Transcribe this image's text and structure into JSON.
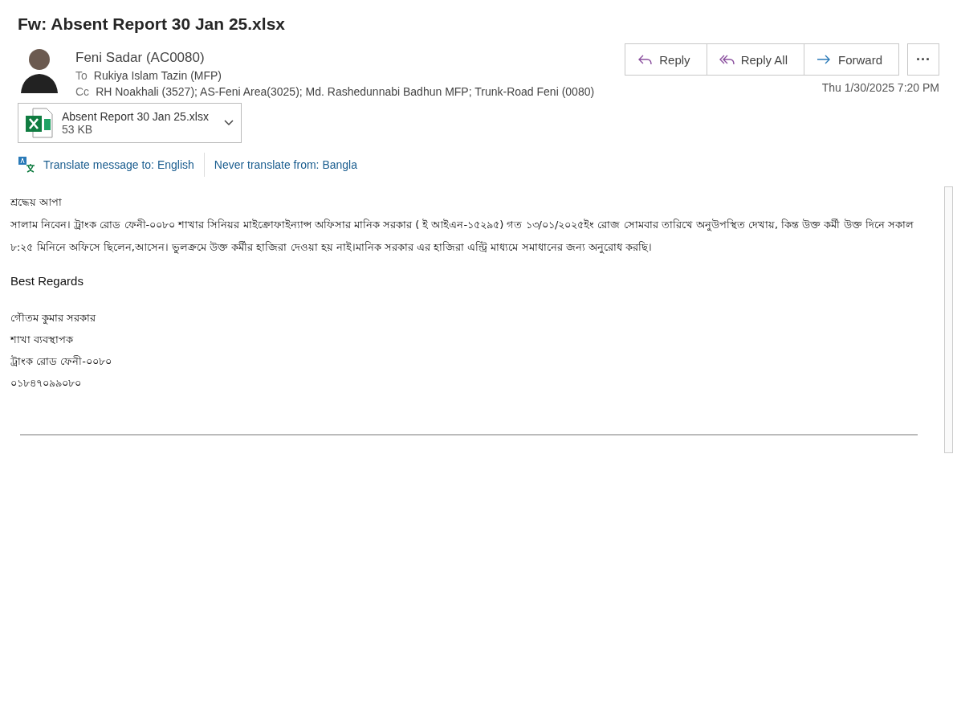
{
  "subject": "Fw: Absent Report 30 Jan 25.xlsx",
  "sender": {
    "name": "Feni Sadar (AC0080)",
    "to_label": "To",
    "to": "Rukiya Islam Tazin (MFP)",
    "cc_label": "Cc",
    "cc": "RH Noakhali (3527); AS-Feni Area(3025); Md. Rashedunnabi Badhun MFP; Trunk-Road Feni (0080)"
  },
  "actions": [
    {
      "kind": "reply",
      "label": "Reply"
    },
    {
      "kind": "reply_all",
      "label": "Reply All"
    },
    {
      "kind": "forward",
      "label": "Forward"
    }
  ],
  "more_label": "···",
  "date": "Thu 1/30/2025 7:20 PM",
  "attachment": {
    "name": "Absent Report 30 Jan 25.xlsx",
    "size": "53 KB"
  },
  "translate": {
    "link": "Translate message to: English",
    "never": "Never translate from: Bangla"
  },
  "body": {
    "greeting": "শ্রদ্ধেয় আপা",
    "paragraph": "সালাম নিবেন। ট্রাংক রোড ফেনী-০০৮০ শাখার সিনিয়র মাইক্রোফাইন্যান্স অফিসার মানিক সরকার ( ই আইএন-১৫২৯৫) গত ১৩/০১/২০২৫ইং  রোজ সোমবার তারিখে অনুউপস্থিত দেখায়,  কিন্ত উক্ত কর্মী উক্ত দিনে সকাল ৮:২৫ মিনিনে অফিসে  ছিলেন,আসেন। ভুলক্রমে উক্ত কর্মীর হাজিরা  দেওয়া হয় নাই।মানিক সরকার এর হাজিরা এন্ট্রি মাধ্যমে সমাধানের জন্য অনুরোধ করছি।",
    "closing": "Best Regards",
    "signature": [
      "গৌতম কুমার সরকার",
      "শাখা ব্যবস্থাপক",
      "ট্রাংক রোড ফেনী-০০৮০",
      "০১৮৪৭০৯৯০৮০"
    ]
  }
}
